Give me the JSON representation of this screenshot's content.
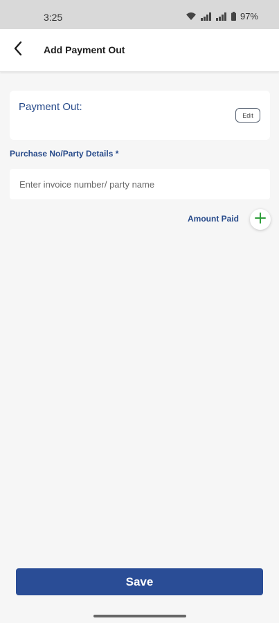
{
  "status_bar": {
    "time": "3:25",
    "battery": "97%",
    "icons": [
      "wifi-icon",
      "signal-icon",
      "signal-icon",
      "battery-icon"
    ]
  },
  "app_bar": {
    "title": "Add Payment Out",
    "back_icon": "back-arrow-icon"
  },
  "payment_card": {
    "label": "Payment Out:",
    "edit_label": "Edit"
  },
  "purchase_field": {
    "label": "Purchase No/Party Details *",
    "placeholder": "Enter invoice number/ party name",
    "value": ""
  },
  "amount_paid": {
    "label": "Amount Paid",
    "add_icon": "plus-icon"
  },
  "footer": {
    "save_label": "Save"
  },
  "colors": {
    "accent": "#2a4d96",
    "label_blue": "#274a8a",
    "add_green": "#2e9e3a",
    "background": "#f6f6f6"
  }
}
